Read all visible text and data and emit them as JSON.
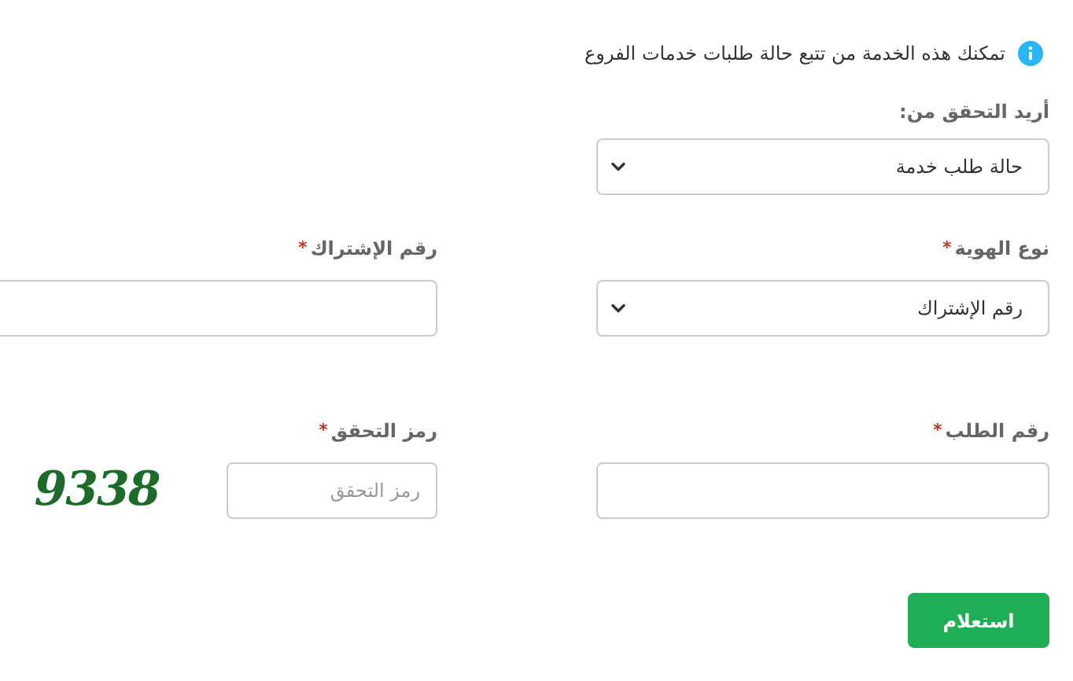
{
  "info": {
    "text": "تمكنك هذه الخدمة من تتبع حالة طلبات خدمات الفروع"
  },
  "verify": {
    "label": "أريد التحقق من:",
    "value": "حالة طلب خدمة"
  },
  "rows": [
    [
      {
        "kind": "select",
        "label": "نوع الهوية",
        "marker": "*",
        "value": "رقم الإشتراك"
      },
      {
        "kind": "text",
        "label": "رقم الإشتراك",
        "marker": "*"
      }
    ],
    [
      {
        "kind": "text",
        "label": "رقم الطلب",
        "marker": "*"
      },
      {
        "kind": "captcha",
        "label": "رمز التحقق",
        "marker": "*",
        "placeholder": "رمز التحقق",
        "code": "9338"
      }
    ]
  ],
  "button": "استعلام"
}
